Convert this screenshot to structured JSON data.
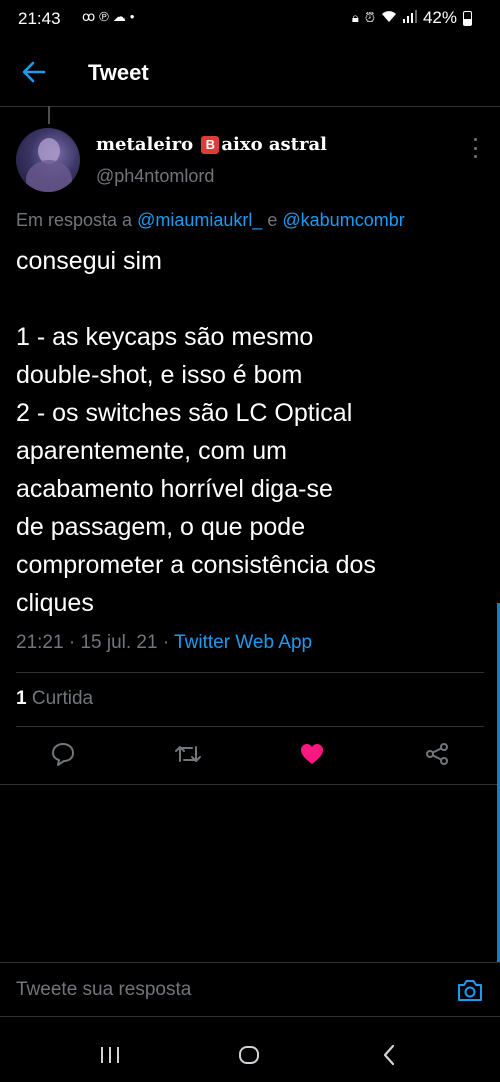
{
  "status_bar": {
    "time": "21:43",
    "left_icons": [
      "voicemail-icon",
      "pinterest-icon",
      "cloud-icon",
      "dot-icon"
    ],
    "right_icons": [
      "lock-icon",
      "alarm-icon",
      "wifi-icon",
      "signal-icon",
      "battery-icon"
    ],
    "battery": "42%"
  },
  "header": {
    "title": "Tweet",
    "back_icon": "arrow-left-icon"
  },
  "tweet": {
    "author": {
      "name_prefix": "metaleiro ",
      "name_badge": "B",
      "name_suffix": "aixo astral",
      "handle": "@ph4ntomlord"
    },
    "reply_to": {
      "prefix": "Em resposta a ",
      "user1": "@miaumiaukrl_",
      "conjunction": " e ",
      "user2": "@kabumcombr"
    },
    "text": "consegui sim\n\n1 - as keycaps são mesmo\ndouble-shot, e isso é bom\n2 - os switches são LC Optical\naparentemente, com um\nacabamento horrível diga-se\nde passagem, o que pode\ncomprometer a consistência dos\ncliques",
    "time": "21:21",
    "date": "15 jul. 21",
    "separator": " · ",
    "source": "Twitter Web App",
    "likes_count": "1",
    "likes_label": " Curtida",
    "liked": true
  },
  "actions": [
    "reply-icon",
    "retweet-icon",
    "heart-icon",
    "share-icon"
  ],
  "composer": {
    "placeholder": "Tweete sua resposta"
  },
  "nav": [
    "recents-icon",
    "home-icon",
    "back-icon"
  ],
  "colors": {
    "background": "#000000",
    "accent": "#1d9bf0",
    "muted": "#71767b",
    "like": "#f91880",
    "divider": "#2f3336"
  }
}
